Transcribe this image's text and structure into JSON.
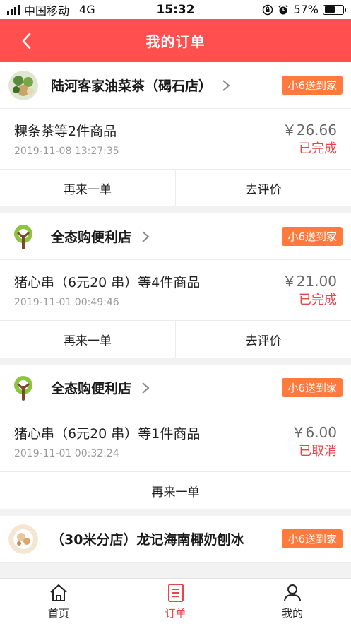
{
  "status_bar": {
    "carrier": "中国移动",
    "network": "4G",
    "time": "15:32",
    "battery": "57%",
    "battery_level": 0.57
  },
  "header": {
    "title": "我的订单"
  },
  "orders": [
    {
      "shop": "陆河客家油菜茶（碣石店）",
      "tag": "小6送到家",
      "items": "粿条茶等2件商品",
      "time": "2019-11-08 13:27:35",
      "price": "￥26.66",
      "status": "已完成",
      "actions": [
        "再来一单",
        "去评价"
      ],
      "logo": "food-photo-icon"
    },
    {
      "shop": "全态购便利店",
      "tag": "小6送到家",
      "items": "猪心串（6元20 串）等4件商品",
      "time": "2019-11-01 00:49:46",
      "price": "￥21.00",
      "status": "已完成",
      "actions": [
        "再来一单",
        "去评价"
      ],
      "logo": "tree-logo-icon"
    },
    {
      "shop": "全态购便利店",
      "tag": "小6送到家",
      "items": "猪心串（6元20 串）等1件商品",
      "time": "2019-11-01 00:32:24",
      "price": "￥6.00",
      "status": "已取消",
      "actions": [
        "再来一单"
      ],
      "logo": "tree-logo-icon"
    },
    {
      "shop": "（30米分店）龙记海南椰奶刨冰",
      "tag": "小6送到家",
      "logo": "food-photo-icon"
    }
  ],
  "tabs": [
    {
      "label": "首页",
      "icon": "home-icon"
    },
    {
      "label": "订单",
      "icon": "order-list-icon",
      "active": true
    },
    {
      "label": "我的",
      "icon": "profile-icon"
    }
  ],
  "colors": {
    "accent": "#ff4f4f",
    "status": "#e8444a",
    "tag": "#ff7a3c"
  }
}
